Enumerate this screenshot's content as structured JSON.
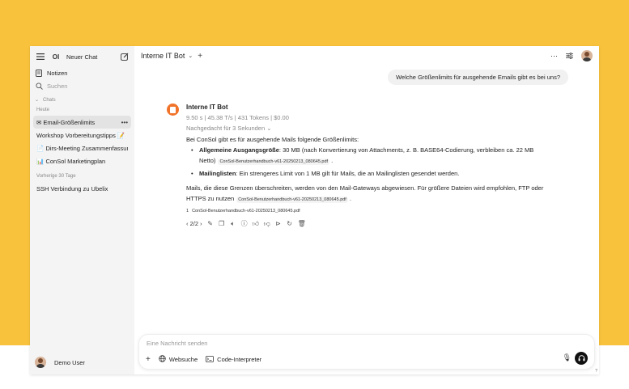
{
  "sidebar": {
    "new_chat": "Neuer Chat",
    "notes": "Notizen",
    "search_placeholder": "Suchen",
    "chats_section": "Chats",
    "groups": [
      {
        "label": "Heute",
        "items": [
          {
            "label": "Email-Größenlimits",
            "active": true
          },
          {
            "label": "Workshop Vorbereitungstipps"
          },
          {
            "label": "Dirs-Meeting Zusammenfassung"
          },
          {
            "label": "ConSol Marketingplan"
          }
        ]
      },
      {
        "label": "Vorherige 30 Tage",
        "items": [
          {
            "label": "SSH Verbindung zu Ubelix"
          }
        ]
      }
    ],
    "user_name": "Demo User"
  },
  "header": {
    "model": "Interne IT Bot"
  },
  "conversation": {
    "user_message": "Welche Größenlimits für ausgehende Emails gibt es bei uns?",
    "bot": {
      "name": "Interne IT Bot",
      "stats": "9.50 s | 45.38 T/s | 431 Tokens | $0.00",
      "thought": "Nachgedacht für 3 Sekunden",
      "intro": "Bei ConSol gibt es für ausgehende Mails folgende Größenlimits:",
      "bullet1_bold": "Allgemeine Ausgangsgröße",
      "bullet1_text": ": 30 MB (nach Konvertierung von Attachments, z. B. BASE64-Codierung, verbleiben ca. 22 MB Netto)",
      "bullet2_bold": "Mailinglisten",
      "bullet2_text": ": Ein strengeres Limit von 1 MB gilt für Mails, die an Mailinglisten gesendet werden.",
      "para": "Mails, die diese Grenzen überschreiten, werden von den Mail-Gateways abgewiesen. Für größere Dateien wird empfohlen, FTP oder HTTPS zu nutzen",
      "citation": "ConSol-Benutzerhandbuch-v61-20250213_080645.pdf",
      "source_num": "1",
      "source_name": "ConSol-Benutzerhandbuch-v61-20250213_080645.pdf",
      "pager": "2/2"
    }
  },
  "composer": {
    "placeholder": "Eine Nachricht senden",
    "websearch": "Websuche",
    "code_interpreter": "Code-Interpreter",
    "help": "?"
  },
  "colors": {
    "background": "#f8c23c",
    "bot_avatar": "#f1732a",
    "sidebar": "#f4f4f4"
  }
}
